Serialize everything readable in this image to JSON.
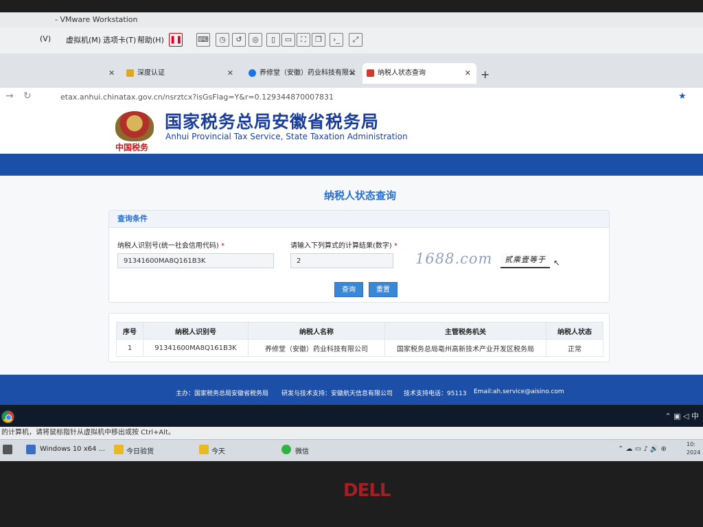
{
  "vmware": {
    "title": "- VMware Workstation",
    "menu": [
      "(V)",
      "虚拟机(M)",
      "选项卡(T)",
      "帮助(H)"
    ]
  },
  "browser": {
    "tabs": [
      {
        "label": "深度认证"
      },
      {
        "label": "养修堂（安徽）药业科技有限公"
      },
      {
        "label": "纳税人状态查询"
      }
    ],
    "url": "etax.anhui.chinatax.gov.cn/nsrztcx?isGsFlag=Y&r=0.129344870007831"
  },
  "site": {
    "title_cn": "国家税务总局安徽省税务局",
    "title_en": "Anhui Provincial Tax Service, State Taxation Administration",
    "slogan": "中国税务"
  },
  "query": {
    "page_title": "纳税人状态查询",
    "panel_title": "查询条件",
    "id_label": "纳税人识别号(统一社会信用代码)",
    "id_value": "91341600MA8Q161B3K",
    "captcha_label": "请输入下列算式的计算结果(数字)",
    "captcha_value": "2",
    "captcha_text": "贰乘壹等于",
    "required_mark": "*",
    "search_label": "查询",
    "reset_label": "重置",
    "watermark": "1688.com"
  },
  "results": {
    "headers": [
      "序号",
      "纳税人识别号",
      "纳税人名称",
      "主管税务机关",
      "纳税人状态"
    ],
    "rows": [
      [
        "1",
        "91341600MA8Q161B3K",
        "养修堂（安徽）药业科技有限公司",
        "国家税务总局亳州高新技术产业开发区税务局",
        "正常"
      ]
    ]
  },
  "footer": {
    "host": "主办：国家税务总局安徽省税务局",
    "dev": "研发与技术支持：安徽航天信息有限公司",
    "phone": "技术支持电话：95113",
    "email": "Email:ah.service@aisino.com"
  },
  "host": {
    "status_text": "的计算机，请将鼠标指针从虚拟机中移出或按 Ctrl+Alt。",
    "taskbar": [
      "Windows 10 x64 ...",
      "今日验货",
      "今天",
      "微信"
    ],
    "clock_time": "10:",
    "clock_date": "2024"
  },
  "brand": "DELL",
  "colors": {
    "brand_blue": "#1b4fa8",
    "title_blue": "#1c3e9b",
    "accent": "#2b6fcb",
    "dell_red": "#a81d22"
  }
}
